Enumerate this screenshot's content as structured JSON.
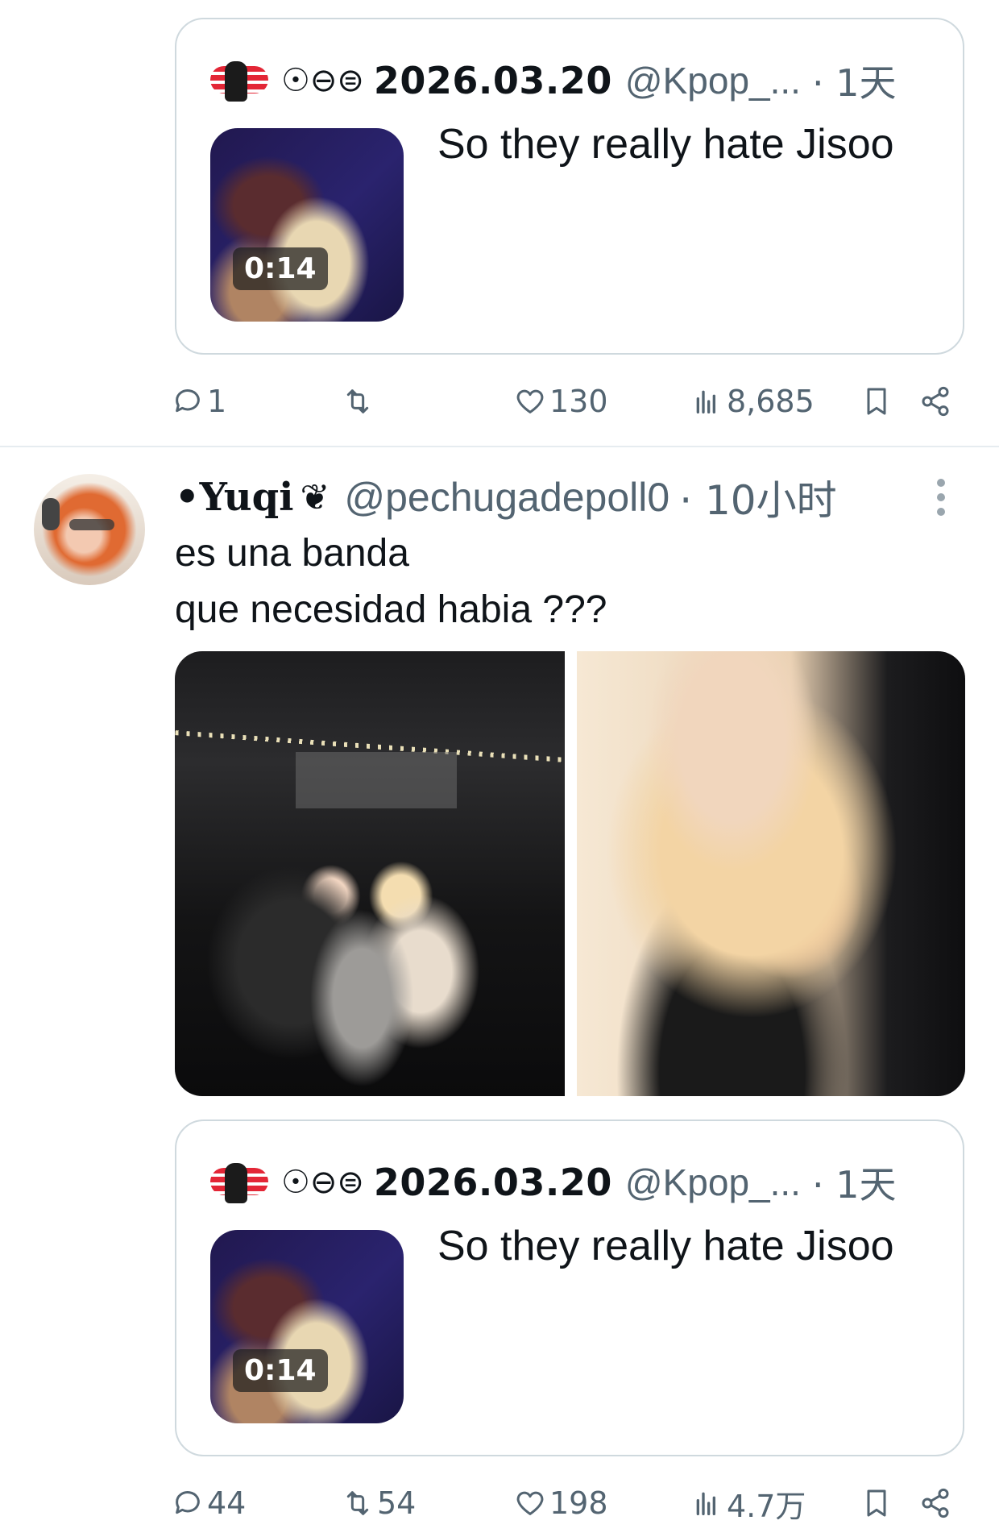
{
  "quoted_tweet": {
    "symbols": "☉⊖⊜",
    "date_name": "2026.03.20",
    "handle": "@Kpop_...",
    "time": "· 1天",
    "video_duration": "0:14",
    "text": "So they really hate Jisoo"
  },
  "first_actions": {
    "replies": "1",
    "retweets": "",
    "likes": "130",
    "views": "8,685"
  },
  "tweet": {
    "display_name": "•Yuqi",
    "name_emoji": "❦",
    "handle": "@pechugadepoll0",
    "time": "· 10小时",
    "text_lines": [
      "es una banda",
      "que necesidad habia ???"
    ],
    "actions": {
      "replies": "44",
      "retweets": "54",
      "likes": "198",
      "views": "4.7万"
    }
  },
  "icons": {
    "reply": "reply-icon",
    "retweet": "retweet-icon",
    "like": "heart-icon",
    "views": "views-icon",
    "bookmark": "bookmark-icon",
    "share": "share-icon",
    "more": "more-icon"
  },
  "colors": {
    "text": "#0f1419",
    "secondary": "#536471",
    "border": "#cfd9de"
  }
}
